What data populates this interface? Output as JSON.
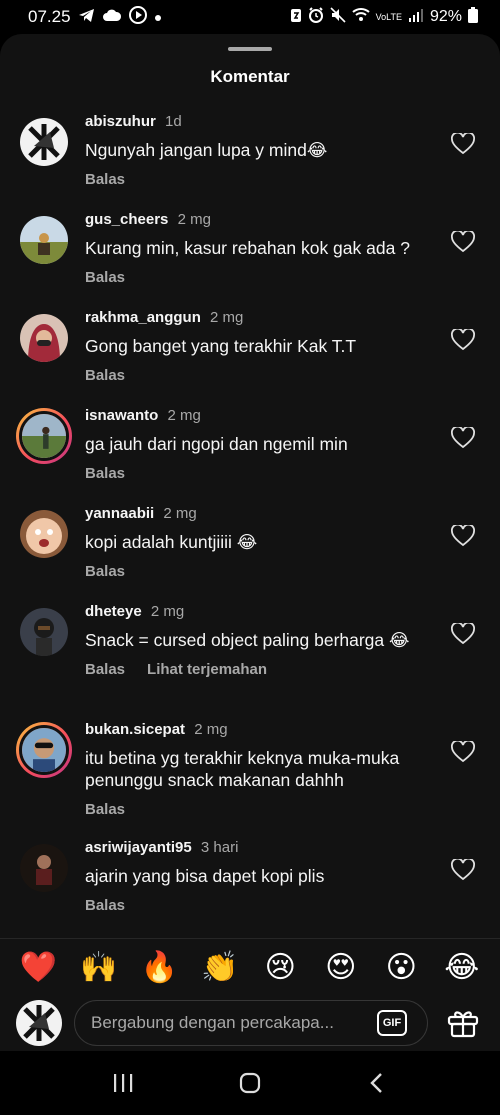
{
  "status": {
    "time": "07.25",
    "battery": "92%",
    "network_label": "VoLTE"
  },
  "sheet": {
    "title": "Komentar"
  },
  "comments": [
    {
      "user": "abiszuhur",
      "time": "1d",
      "text": "Ngunyah jangan lupa y mind😂",
      "reply": "Balas",
      "translate": ""
    },
    {
      "user": "gus_cheers",
      "time": "2 mg",
      "text": "Kurang min, kasur rebahan kok gak ada ?",
      "reply": "Balas",
      "translate": ""
    },
    {
      "user": "rakhma_anggun",
      "time": "2 mg",
      "text": "Gong banget yang terakhir Kak T.T",
      "reply": "Balas",
      "translate": ""
    },
    {
      "user": "isnawanto",
      "time": "2 mg",
      "text": "ga jauh dari ngopi dan ngemil min",
      "reply": "Balas",
      "translate": ""
    },
    {
      "user": "yannaabii",
      "time": "2 mg",
      "text": "kopi adalah kuntjiiii 😂",
      "reply": "Balas",
      "translate": ""
    },
    {
      "user": "dheteye",
      "time": "2 mg",
      "text": "Snack = cursed object paling berharga 😂",
      "reply": "Balas",
      "translate": "Lihat terjemahan"
    },
    {
      "user": "bukan.sicepat",
      "time": "2 mg",
      "text": "itu betina yg terakhir keknya muka-muka penunggu snack makanan dahhh",
      "reply": "Balas",
      "translate": ""
    },
    {
      "user": "asriwijayanti95",
      "time": "3 hari",
      "text": "ajarin yang bisa dapet kopi plis",
      "reply": "Balas",
      "translate": ""
    }
  ],
  "reactions": [
    "❤️",
    "🙌",
    "🔥",
    "👏",
    "😢",
    "😍",
    "😮",
    "😂"
  ],
  "composer": {
    "placeholder": "Bergabung dengan percakapa...",
    "gif_label": "GIF"
  },
  "colors": {
    "sheet_bg": "#121212",
    "secondary_text": "#a8a8a8",
    "story_ring": "#f54d5c"
  }
}
